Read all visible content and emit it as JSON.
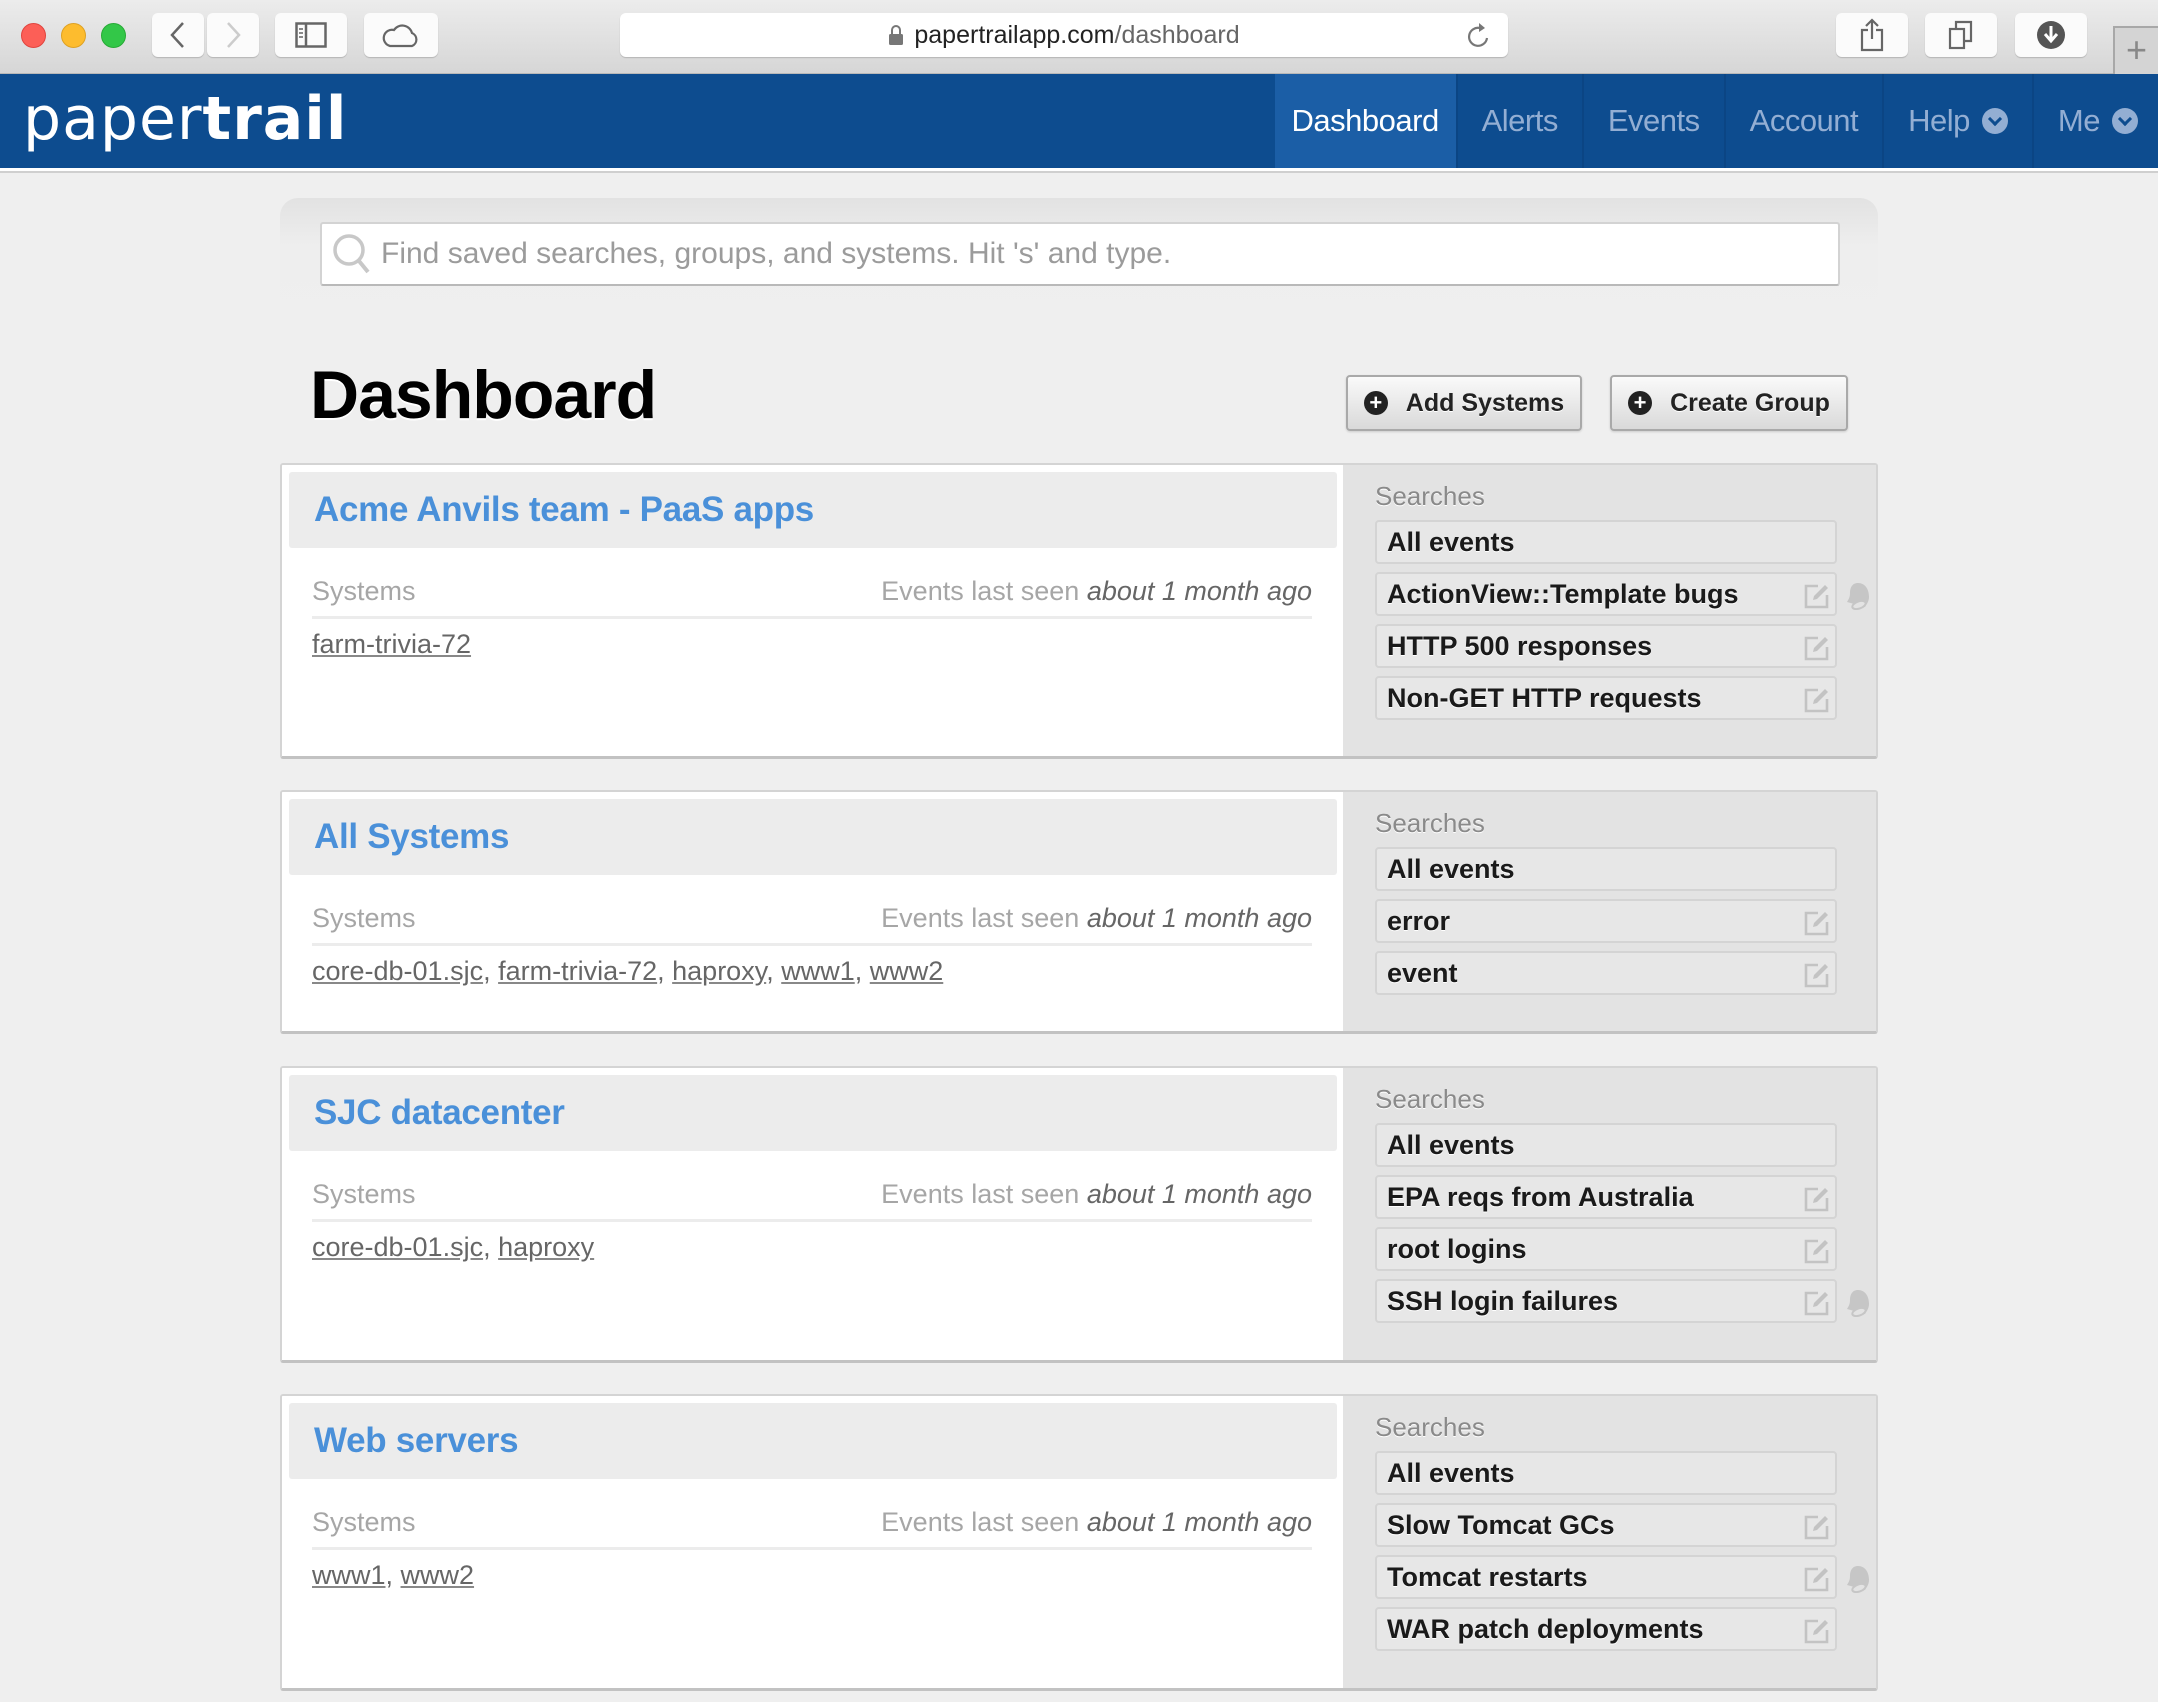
{
  "browser": {
    "url_domain": "papertrailapp.com",
    "url_path": "/dashboard",
    "new_tab_label": "+"
  },
  "nav": {
    "logo_light": "paper",
    "logo_bold": "trail",
    "items": [
      {
        "label": "Dashboard",
        "active": true,
        "dropdown": false
      },
      {
        "label": "Alerts",
        "active": false,
        "dropdown": false
      },
      {
        "label": "Events",
        "active": false,
        "dropdown": false
      },
      {
        "label": "Account",
        "active": false,
        "dropdown": false
      },
      {
        "label": "Help",
        "active": false,
        "dropdown": true
      },
      {
        "label": "Me",
        "active": false,
        "dropdown": true
      }
    ]
  },
  "search": {
    "placeholder": "Find saved searches, groups, and systems. Hit 's' and type.",
    "value": ""
  },
  "page": {
    "title": "Dashboard",
    "add_systems_label": "Add Systems",
    "create_group_label": "Create Group"
  },
  "colors": {
    "nav_bg": "#0d4c8f",
    "nav_active": "#1b5ea6",
    "link_blue": "#4a90d9"
  },
  "groups": [
    {
      "title": "Acme Anvils team - PaaS apps",
      "systems_label": "Systems",
      "seen_prefix": "Events last seen",
      "seen_value": "about 1 month ago",
      "systems": [
        "farm-trivia-72"
      ],
      "searches_label": "Searches",
      "searches": [
        {
          "name": "All events",
          "editable": false,
          "alert": false
        },
        {
          "name": "ActionView::Template bugs",
          "editable": true,
          "alert": true
        },
        {
          "name": "HTTP 500 responses",
          "editable": true,
          "alert": false
        },
        {
          "name": "Non-GET HTTP requests",
          "editable": true,
          "alert": false
        }
      ]
    },
    {
      "title": "All Systems",
      "systems_label": "Systems",
      "seen_prefix": "Events last seen",
      "seen_value": "about 1 month ago",
      "systems": [
        "core-db-01.sjc",
        "farm-trivia-72",
        "haproxy",
        "www1",
        "www2"
      ],
      "searches_label": "Searches",
      "searches": [
        {
          "name": "All events",
          "editable": false,
          "alert": false
        },
        {
          "name": "error",
          "editable": true,
          "alert": false
        },
        {
          "name": "event",
          "editable": true,
          "alert": false
        }
      ]
    },
    {
      "title": "SJC datacenter",
      "systems_label": "Systems",
      "seen_prefix": "Events last seen",
      "seen_value": "about 1 month ago",
      "systems": [
        "core-db-01.sjc",
        "haproxy"
      ],
      "searches_label": "Searches",
      "searches": [
        {
          "name": "All events",
          "editable": false,
          "alert": false
        },
        {
          "name": "EPA reqs from Australia",
          "editable": true,
          "alert": false
        },
        {
          "name": "root logins",
          "editable": true,
          "alert": false
        },
        {
          "name": "SSH login failures",
          "editable": true,
          "alert": true
        }
      ]
    },
    {
      "title": "Web servers",
      "systems_label": "Systems",
      "seen_prefix": "Events last seen",
      "seen_value": "about 1 month ago",
      "systems": [
        "www1",
        "www2"
      ],
      "searches_label": "Searches",
      "searches": [
        {
          "name": "All events",
          "editable": false,
          "alert": false
        },
        {
          "name": "Slow Tomcat GCs",
          "editable": true,
          "alert": false
        },
        {
          "name": "Tomcat restarts",
          "editable": true,
          "alert": true
        },
        {
          "name": "WAR patch deployments",
          "editable": true,
          "alert": false
        }
      ]
    }
  ]
}
